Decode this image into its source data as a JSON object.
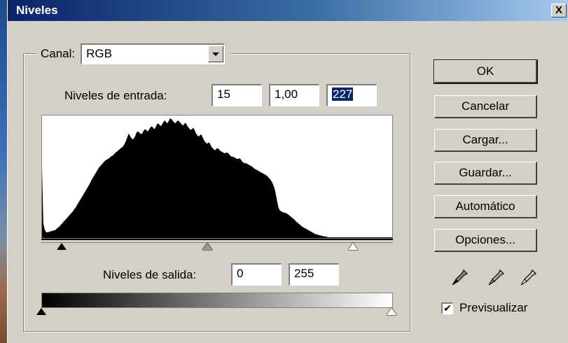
{
  "window": {
    "title": "Niveles",
    "close_label": "X"
  },
  "channel": {
    "label": "Canal:",
    "value": "RGB"
  },
  "input_levels": {
    "label": "Niveles de entrada:",
    "black": "15",
    "gamma": "1,00",
    "white": "227"
  },
  "output_levels": {
    "label": "Niveles de salida:",
    "black": "0",
    "white": "255"
  },
  "input_sliders": {
    "black_value": 15,
    "gamma_value": 1.0,
    "white_value": 227,
    "range": [
      0,
      255
    ]
  },
  "output_sliders": {
    "black_value": 0,
    "white_value": 255
  },
  "buttons": {
    "ok": "OK",
    "cancel": "Cancelar",
    "load": "Cargar...",
    "save": "Guardar...",
    "auto": "Automático",
    "options": "Opciones..."
  },
  "preview": {
    "label": "Previsualizar",
    "checked": true
  },
  "histogram": {
    "range": [
      0,
      255
    ],
    "counts": [
      96,
      20,
      12,
      8,
      8,
      8,
      9,
      9,
      10,
      10,
      11,
      12,
      14,
      15,
      17,
      19,
      21,
      23,
      25,
      27,
      29,
      31,
      33,
      35,
      37,
      40,
      42,
      45,
      48,
      51,
      54,
      57,
      60,
      63,
      66,
      69,
      72,
      75,
      79,
      82,
      85,
      88,
      91,
      94,
      97,
      99,
      101,
      103,
      105,
      107,
      108,
      109,
      110,
      112,
      113,
      114,
      116,
      118,
      119,
      121,
      122,
      124,
      125,
      127,
      130,
      134,
      139,
      144,
      141,
      138,
      136,
      137,
      140,
      145,
      147,
      146,
      144,
      143,
      146,
      149,
      150,
      148,
      147,
      150,
      153,
      154,
      152,
      150,
      153,
      157,
      158,
      156,
      154,
      157,
      160,
      162,
      160,
      158,
      161,
      165,
      164,
      162,
      160,
      158,
      160,
      162,
      161,
      159,
      157,
      155,
      157,
      159,
      156,
      153,
      151,
      149,
      150,
      152,
      149,
      145,
      142,
      140,
      141,
      143,
      140,
      136,
      133,
      131,
      130,
      132,
      130,
      126,
      124,
      122,
      121,
      123,
      124,
      122,
      120,
      119,
      118,
      117,
      117,
      118,
      117,
      115,
      113,
      112,
      112,
      111,
      110,
      109,
      109,
      110,
      108,
      105,
      104,
      103,
      103,
      102,
      101,
      100,
      99,
      98,
      96,
      95,
      94,
      93,
      92,
      91,
      90,
      89,
      88,
      87,
      86,
      84,
      82,
      80,
      77,
      73,
      68,
      60,
      50,
      42,
      38,
      37,
      36,
      35,
      35,
      34,
      33,
      32,
      30,
      29,
      27,
      26,
      24,
      22,
      21,
      19,
      18,
      16,
      15,
      14,
      13,
      12,
      11,
      10,
      9,
      8,
      7,
      6,
      5,
      5,
      4,
      4,
      3,
      3,
      2,
      2,
      2,
      1,
      1,
      1,
      1,
      1,
      1,
      1,
      1,
      1,
      1,
      1,
      1,
      1,
      1,
      1,
      1,
      1,
      1,
      1,
      1,
      1,
      1,
      1,
      1,
      1,
      1,
      1,
      1,
      1,
      1,
      1,
      1,
      1,
      1,
      1,
      1,
      1,
      1,
      1,
      1,
      1,
      1,
      1,
      1,
      1,
      1,
      1,
      1,
      1,
      1,
      1
    ]
  }
}
